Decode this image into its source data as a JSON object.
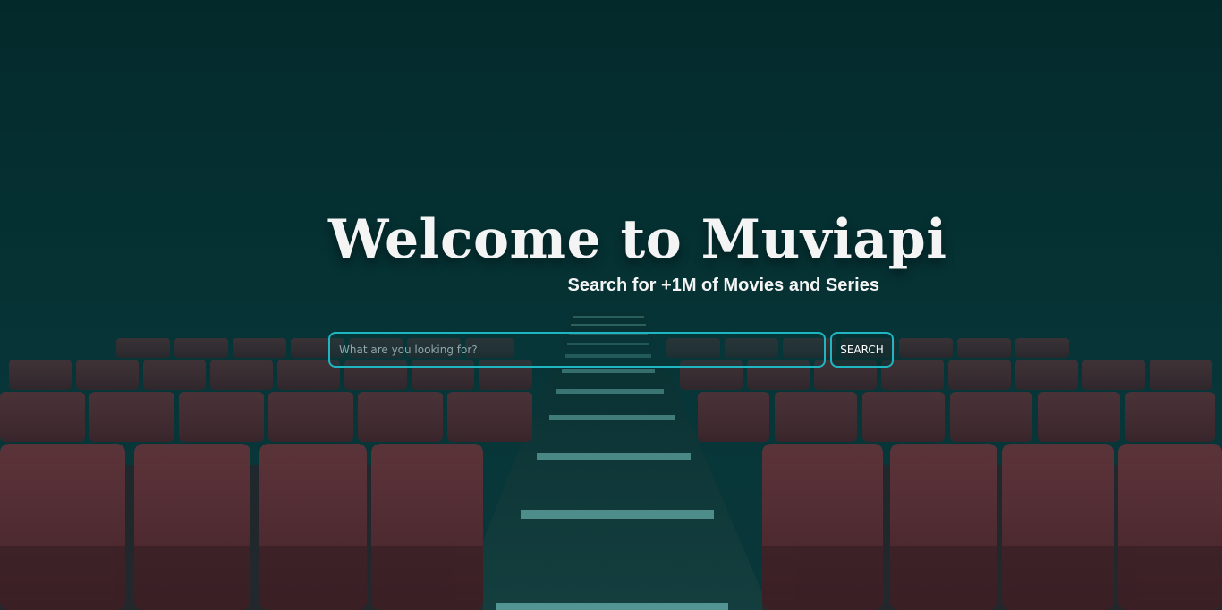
{
  "hero": {
    "title": "Welcome to Muviapi",
    "subtitle": "Search for +1M of Movies and Series"
  },
  "search": {
    "placeholder": "What are you looking for?",
    "value": "",
    "button_label": "SEARCH"
  },
  "colors": {
    "accent": "#1fb5c1",
    "overlay": "#04282a",
    "seat": "#6b2a30",
    "text": "#f4f4f4"
  },
  "background": {
    "image_name": "cinema-seats-background"
  }
}
